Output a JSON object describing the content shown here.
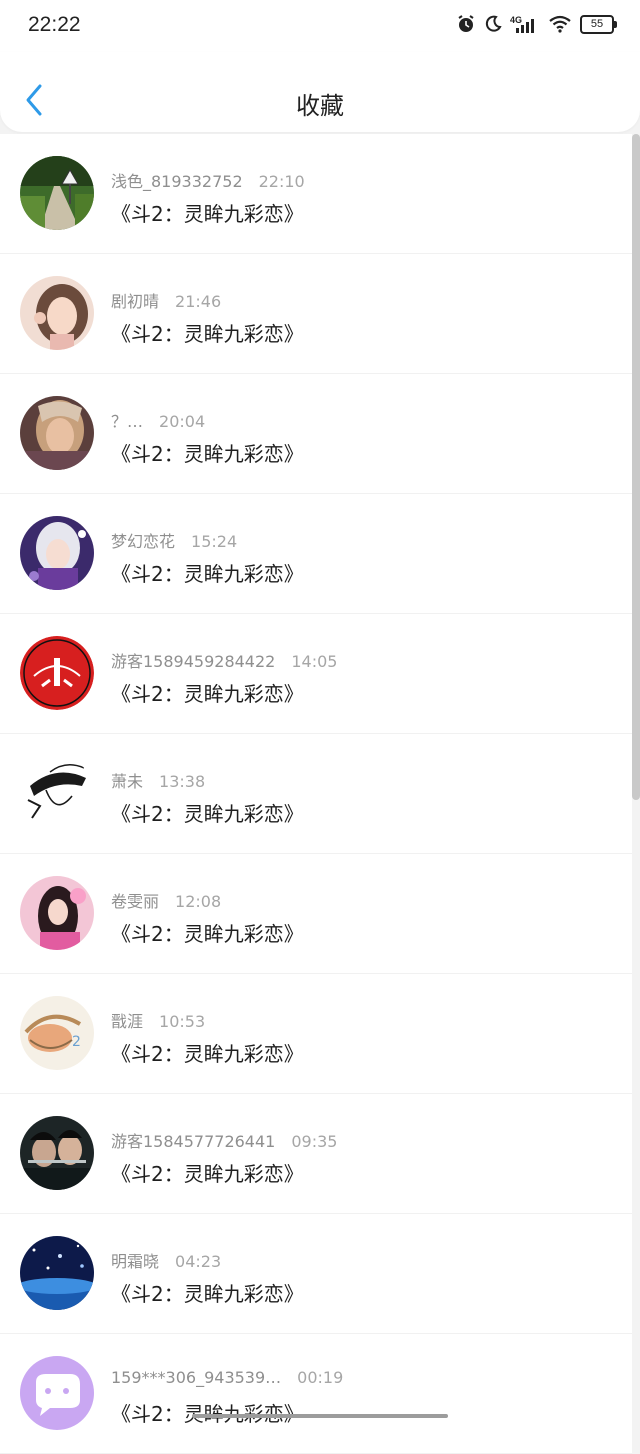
{
  "status": {
    "time": "22:22",
    "battery": "55",
    "network": "4G"
  },
  "header": {
    "title": "收藏"
  },
  "colors": {
    "accent": "#2e9ae8"
  },
  "items": [
    {
      "user": "浅色_819332752",
      "time": "22:10",
      "title": "《斗2：灵眸九彩恋》",
      "avatar": "forest-road"
    },
    {
      "user": "剧初晴",
      "time": "21:46",
      "title": "《斗2：灵眸九彩恋》",
      "avatar": "girl-portrait"
    },
    {
      "user": "？…",
      "time": "20:04",
      "title": "《斗2：灵眸九彩恋》",
      "avatar": "fantasy-portrait"
    },
    {
      "user": "梦幻恋花",
      "time": "15:24",
      "title": "《斗2：灵眸九彩恋》",
      "avatar": "anime-girl"
    },
    {
      "user": "游客1589459284422",
      "time": "14:05",
      "title": "《斗2：灵眸九彩恋》",
      "avatar": "red-seal"
    },
    {
      "user": "萧未",
      "time": "13:38",
      "title": "《斗2：灵眸九彩恋》",
      "avatar": "sketch-boy"
    },
    {
      "user": "卷雯丽",
      "time": "12:08",
      "title": "《斗2：灵眸九彩恋》",
      "avatar": "pink-girl"
    },
    {
      "user": "戬涯",
      "time": "10:53",
      "title": "《斗2：灵眸九彩恋》",
      "avatar": "basket-drawing"
    },
    {
      "user": "游客1584577726441",
      "time": "09:35",
      "title": "《斗2：灵眸九彩恋》",
      "avatar": "two-men"
    },
    {
      "user": "明霜晓",
      "time": "04:23",
      "title": "《斗2：灵眸九彩恋》",
      "avatar": "night-sky"
    },
    {
      "user": "159***306_943539…",
      "time": "00:19",
      "title": "《斗2：灵眸九彩恋》",
      "avatar": "chat-bubble"
    }
  ]
}
